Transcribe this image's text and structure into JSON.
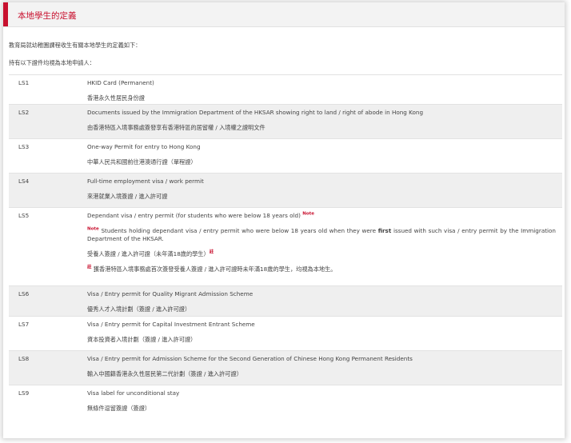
{
  "section_title": "本地學生的定義",
  "intro_line1": "教育局就幼稚園課程收生有關本地學生的定義如下：",
  "intro_line2": "持有以下證件均視為本地申請人：",
  "rows": [
    {
      "code": "LS1",
      "en": "HKID Card (Permanent)",
      "zh": "香港永久性居民身份證"
    },
    {
      "code": "LS2",
      "en": "Documents issued by the Immigration Department of the HKSAR showing right to land / right of abode in Hong Kong",
      "zh": "由香港特區入境事務處簽發享有香港特區的居留權 / 入境權之證明文件"
    },
    {
      "code": "LS3",
      "en": "One-way Permit for entry to Hong Kong",
      "zh": "中華人民共和國前往港澳通行證（單程證）"
    },
    {
      "code": "LS4",
      "en": "Full-time employment visa / work permit",
      "zh": "來港就業入境簽證 / 進入許可證"
    },
    {
      "code": "LS5",
      "en": "Dependant visa / entry permit (for students who were below 18 years old)",
      "note_mark": "Note",
      "note_before": "Students holding dependant visa / entry permit who were below 18 years old when they were ",
      "note_bold": "first",
      "note_after": " issued with such visa / entry permit by the Immigration Department of the HKSAR.",
      "zh": "受養人簽證 / 進入許可證（未年滿18歲的學生）",
      "zh_mark": "註",
      "zh_note": "獲香港特區入境事務處首次簽發受養人簽證 / 進入許可證時未年滿18歲的學生，均視為本地生。"
    },
    {
      "code": "LS6",
      "en": "Visa / Entry permit for Quality Migrant Admission Scheme",
      "zh": "優秀人才入境計劃（簽證 / 進入許可證）"
    },
    {
      "code": "LS7",
      "en": "Visa / Entry permit for Capital Investment Entrant Scheme",
      "zh": "資本投資者入境計劃（簽證 / 進入許可證）"
    },
    {
      "code": "LS8",
      "en": "Visa / Entry permit for Admission Scheme for the Second Generation of Chinese Hong Kong Permanent Residents",
      "zh": "輸入中國籍香港永久性居民第二代計劃（簽證 / 進入許可證）"
    },
    {
      "code": "LS9",
      "en": "Visa label for unconditional stay",
      "zh": "無條件逗留簽證（簽證）"
    }
  ],
  "colors": {
    "accent": "#c8102e",
    "shade": "#efefef",
    "border": "#e2e2e2"
  }
}
